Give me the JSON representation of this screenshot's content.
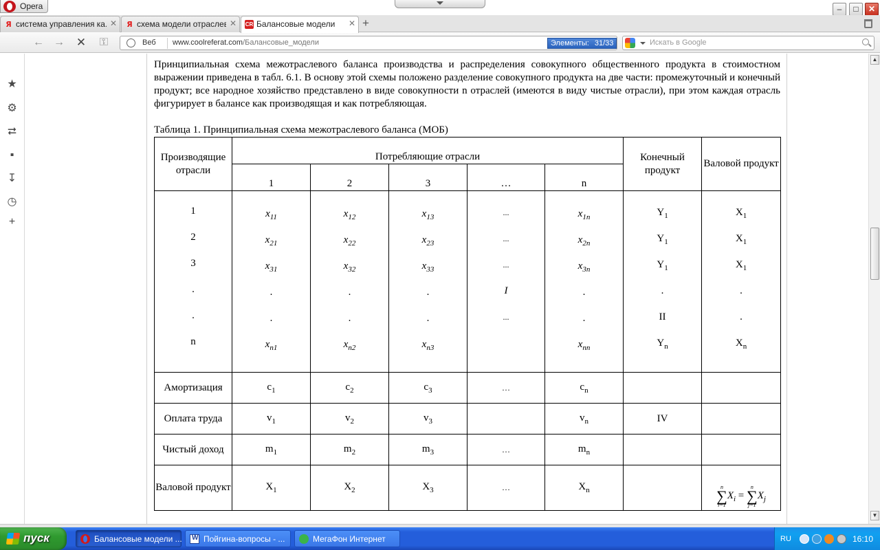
{
  "window": {
    "app_name": "Opera",
    "min_glyph": "–",
    "max_glyph": "□",
    "close_glyph": "✕"
  },
  "tabs": [
    {
      "label": "система управления ка...",
      "favicon": "yandex-icon",
      "fav_glyph": "Я"
    },
    {
      "label": "схема модели отраслев...",
      "favicon": "yandex-icon",
      "fav_glyph": "Я"
    },
    {
      "label": "Балансовые модели",
      "favicon": "coolreferat-icon",
      "fav_glyph": "CR",
      "active": true
    }
  ],
  "tab_close_glyph": "✕",
  "new_tab_glyph": "+",
  "nav": {
    "back_glyph": "←",
    "forward_glyph": "→",
    "stop_glyph": "✕",
    "key_glyph": "⚿"
  },
  "address": {
    "scope_label": "Веб",
    "url_host": "www.coolreferat.com",
    "url_path": "/Балансовые_модели",
    "find_badge_label": "Элементы:",
    "find_badge_count": "31/33"
  },
  "search": {
    "placeholder": "Искать в Google",
    "engine_icon": "google-icon"
  },
  "side_panel": [
    "bookmarks-star-icon",
    "settings-gear-icon",
    "unite-icon",
    "notes-icon",
    "downloads-icon",
    "history-clock-icon",
    "add-panel-icon"
  ],
  "side_panel_glyphs": [
    "★",
    "⚙",
    "⮂",
    "▪",
    "↧",
    "◷",
    "+"
  ],
  "article": {
    "paragraph": "Принципиальная схема межотраслевого баланса производства и распределения совокупного общественного продукта в стоимостном выражении приведена в табл. 6.1. В основу этой схемы положено разделение совокупного продукта на две части: промежуточный и конечный продукт; все народное хозяйство представлено в виде совокупности n отраслей (имеются в виду чистые отрасли), при этом каждая отрасль фигурирует в балансе как производящая и как потребляющая.",
    "table_caption": "Таблица 1. Принципиальная схема межотраслевого баланса (МОБ)"
  },
  "table": {
    "header": {
      "producing": "Производящие отрасли",
      "consuming": "Потребляющие отрасли",
      "final": "Конечный продукт",
      "gross": "Валовой продукт",
      "columns": [
        "1",
        "2",
        "3",
        "…",
        "n"
      ]
    },
    "quadrant1": {
      "row_labels": [
        "1",
        "2",
        "3",
        ".",
        ".",
        "n"
      ],
      "col1": [
        {
          "v": "x",
          "s": "11"
        },
        {
          "v": "x",
          "s": "21"
        },
        {
          "v": "x",
          "s": "31"
        },
        {
          "v": ".",
          "s": ""
        },
        {
          "v": ".",
          "s": ""
        },
        {
          "v": "x",
          "s": "n1"
        }
      ],
      "col2": [
        {
          "v": "x",
          "s": "12"
        },
        {
          "v": "x",
          "s": "22"
        },
        {
          "v": "x",
          "s": "32"
        },
        {
          "v": ".",
          "s": ""
        },
        {
          "v": ".",
          "s": ""
        },
        {
          "v": "x",
          "s": "n2"
        }
      ],
      "col3": [
        {
          "v": "x",
          "s": "13"
        },
        {
          "v": "x",
          "s": "23"
        },
        {
          "v": "x",
          "s": "33"
        },
        {
          "v": ".",
          "s": ""
        },
        {
          "v": ".",
          "s": ""
        },
        {
          "v": "x",
          "s": "n3"
        }
      ],
      "col_dots": [
        "...",
        "...",
        "...",
        "I",
        "..."
      ],
      "coln": [
        {
          "v": "x",
          "s": "1n"
        },
        {
          "v": "x",
          "s": "2n"
        },
        {
          "v": "x",
          "s": "3n"
        },
        {
          "v": ".",
          "s": ""
        },
        {
          "v": ".",
          "s": ""
        },
        {
          "v": "x",
          "s": "nn"
        }
      ],
      "final": [
        {
          "v": "Y",
          "s": "1"
        },
        {
          "v": "Y",
          "s": "1"
        },
        {
          "v": "Y",
          "s": "1"
        },
        {
          "v": ".",
          "s": ""
        },
        {
          "v": "II",
          "s": ""
        },
        {
          "v": "Y",
          "s": "n"
        }
      ],
      "gross": [
        {
          "v": "X",
          "s": "1"
        },
        {
          "v": "X",
          "s": "1"
        },
        {
          "v": "X",
          "s": "1"
        },
        {
          "v": ".",
          "s": ""
        },
        {
          "v": ".",
          "s": ""
        },
        {
          "v": "X",
          "s": "n"
        }
      ]
    },
    "value_added": [
      {
        "label": "Амортизация",
        "cells": [
          {
            "v": "c",
            "s": "1"
          },
          {
            "v": "c",
            "s": "2"
          },
          {
            "v": "c",
            "s": "3"
          },
          {
            "v": "…",
            "s": ""
          },
          {
            "v": "c",
            "s": "n"
          }
        ],
        "final": "",
        "gross": ""
      },
      {
        "label": "Оплата труда",
        "cells": [
          {
            "v": "v",
            "s": "1"
          },
          {
            "v": "v",
            "s": "2"
          },
          {
            "v": "v",
            "s": "3"
          },
          {
            "v": "",
            "s": ""
          },
          {
            "v": "v",
            "s": "n"
          }
        ],
        "final": "IV",
        "gross": ""
      },
      {
        "label": "Чистый доход",
        "cells": [
          {
            "v": "m",
            "s": "1"
          },
          {
            "v": "m",
            "s": "2"
          },
          {
            "v": "m",
            "s": "3"
          },
          {
            "v": "…",
            "s": ""
          },
          {
            "v": "m",
            "s": "n"
          }
        ],
        "final": "",
        "gross": ""
      }
    ],
    "gross_row": {
      "label": "Валовой продукт",
      "cells": [
        {
          "v": "X",
          "s": "1"
        },
        {
          "v": "X",
          "s": "2"
        },
        {
          "v": "X",
          "s": "3"
        },
        {
          "v": "…",
          "s": ""
        },
        {
          "v": "X",
          "s": "n"
        }
      ],
      "formula": {
        "upper": "n",
        "lower_left": "i=1",
        "lower_right": "j=1",
        "left_var": "X",
        "left_sub": "i",
        "eq": "=",
        "right_var": "X",
        "right_sub": "j"
      }
    }
  },
  "taskbar": {
    "start_label": "пуск",
    "items": [
      {
        "label": "Балансовые модели ...",
        "icon": "opera-icon",
        "active": true
      },
      {
        "label": "Пойгина-вопросы - ...",
        "icon": "word-icon"
      },
      {
        "label": "МегаФон Интернет",
        "icon": "megafon-icon"
      }
    ],
    "language": "RU",
    "clock": "16:10"
  },
  "colors": {
    "taskbar_blue": "#245edb",
    "start_green": "#2f9a2f",
    "find_badge_blue": "#2b63bd",
    "opera_red": "#c4151c"
  }
}
